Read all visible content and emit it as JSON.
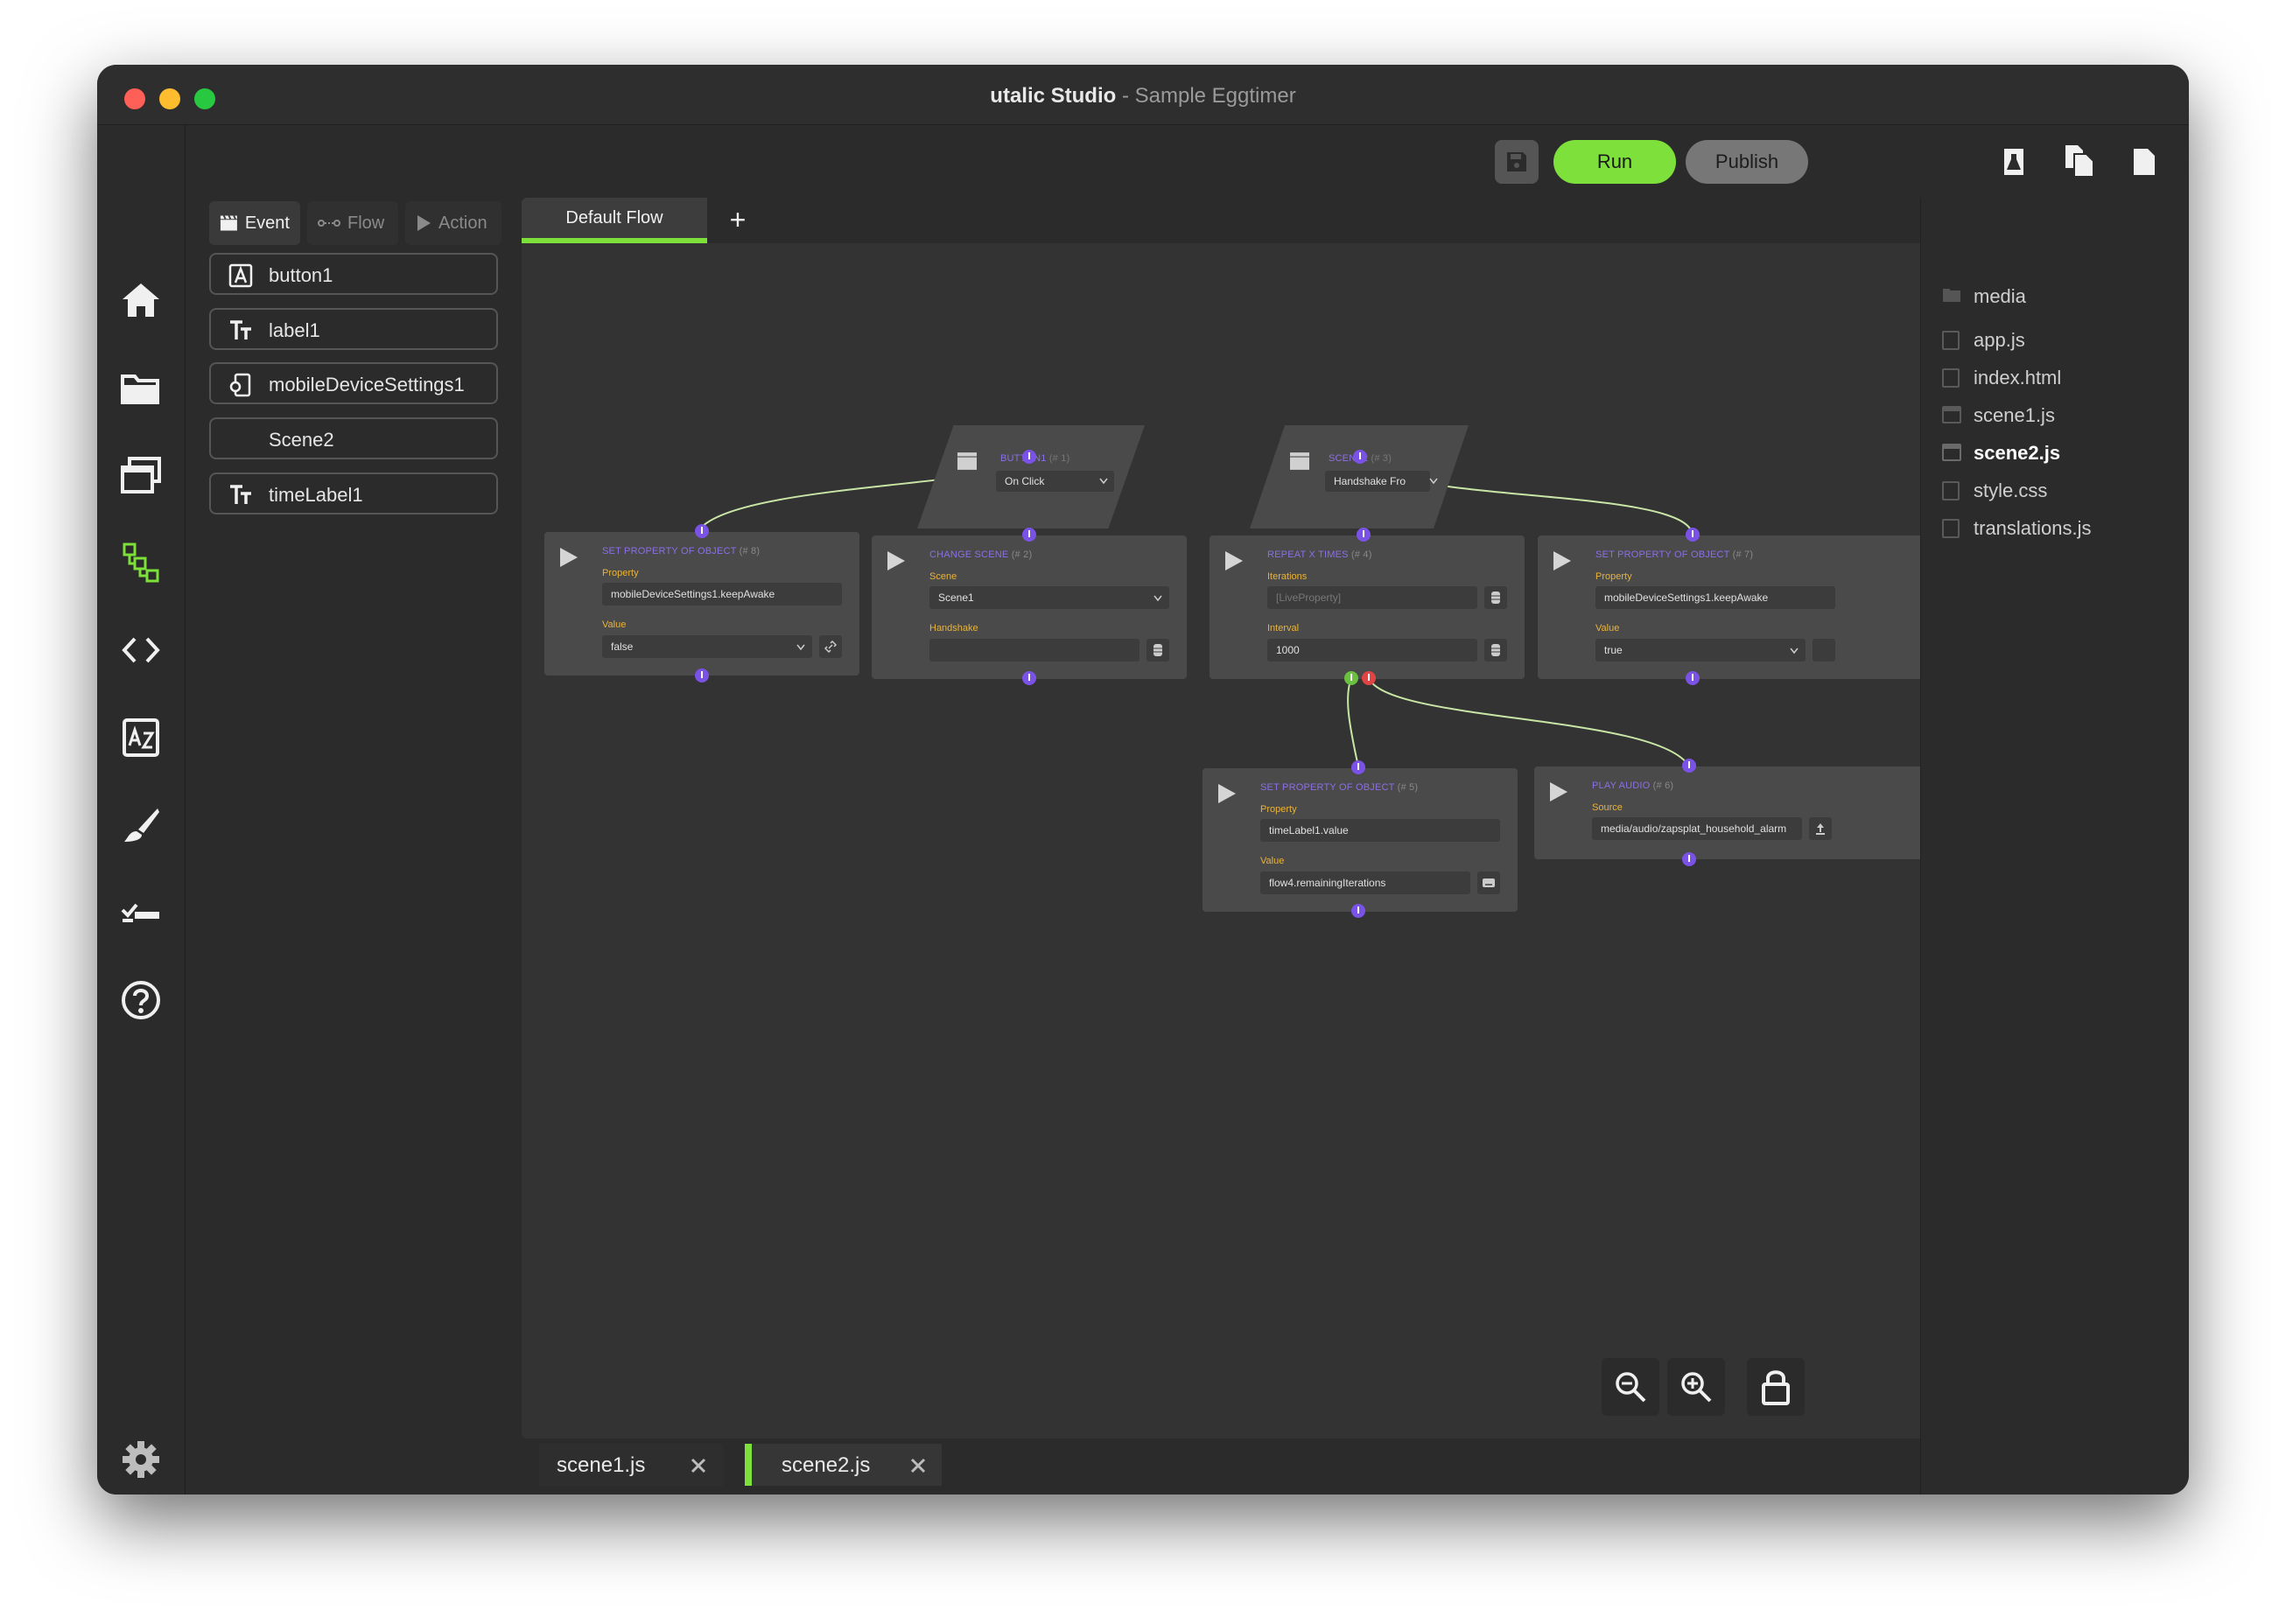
{
  "window": {
    "app_name": "utalic Studio",
    "separator": " - ",
    "project": "Sample Eggtimer"
  },
  "toolbar": {
    "run_label": "Run",
    "publish_label": "Publish"
  },
  "panel": {
    "tabs": [
      {
        "label": "Event",
        "active": true
      },
      {
        "label": "Flow",
        "active": false
      },
      {
        "label": "Action",
        "active": false
      }
    ],
    "items": [
      {
        "label": "button1",
        "icon": "letter-a-icon"
      },
      {
        "label": "label1",
        "icon": "text-icon"
      },
      {
        "label": "mobileDeviceSettings1",
        "icon": "device-settings-icon"
      },
      {
        "label": "Scene2",
        "icon": ""
      },
      {
        "label": "timeLabel1",
        "icon": "text-icon"
      }
    ]
  },
  "canvas": {
    "tab_label": "Default Flow",
    "add_tab": "+",
    "events": [
      {
        "title": "BUTTON1",
        "id": "(# 1)",
        "value": "On Click"
      },
      {
        "title": "SCENE2",
        "id": "(# 3)",
        "value": "Handshake Fro"
      }
    ],
    "nodes": {
      "n8": {
        "title": "SET PROPERTY OF OBJECT",
        "id": "(# 8)",
        "label1": "Property",
        "value1": "mobileDeviceSettings1.keepAwake",
        "label2": "Value",
        "value2": "false"
      },
      "n2": {
        "title": "CHANGE SCENE",
        "id": "(# 2)",
        "label1": "Scene",
        "value1": "Scene1",
        "label2": "Handshake",
        "value2": ""
      },
      "n4": {
        "title": "REPEAT X TIMES",
        "id": "(# 4)",
        "label1": "Iterations",
        "value1": "[LiveProperty]",
        "label2": "Interval",
        "value2": "1000"
      },
      "n7": {
        "title": "SET PROPERTY OF OBJECT",
        "id": "(# 7)",
        "label1": "Property",
        "value1": "mobileDeviceSettings1.keepAwake",
        "label2": "Value",
        "value2": "true"
      },
      "n5": {
        "title": "SET PROPERTY OF OBJECT",
        "id": "(# 5)",
        "label1": "Property",
        "value1": "timeLabel1.value",
        "label2": "Value",
        "value2": "flow4.remainingIterations"
      },
      "n6": {
        "title": "PLAY AUDIO",
        "id": "(# 6)",
        "label1": "Source",
        "value1": "media/audio/zapsplat_household_alarm"
      }
    }
  },
  "files": [
    {
      "name": "media",
      "type": "folder",
      "active": false
    },
    {
      "name": "app.js",
      "type": "file",
      "active": false
    },
    {
      "name": "index.html",
      "type": "file",
      "active": false
    },
    {
      "name": "scene1.js",
      "type": "scene",
      "active": false
    },
    {
      "name": "scene2.js",
      "type": "scene",
      "active": true
    },
    {
      "name": "style.css",
      "type": "file",
      "active": false
    },
    {
      "name": "translations.js",
      "type": "file",
      "active": false
    }
  ],
  "bottom_tabs": [
    {
      "label": "scene1.js",
      "active": false
    },
    {
      "label": "scene2.js",
      "active": true
    }
  ],
  "colors": {
    "accent": "#7ee03a",
    "purple": "#7a52e6",
    "label": "#e9b33a",
    "bg": "#2b2b2b",
    "canvas": "#333333"
  }
}
